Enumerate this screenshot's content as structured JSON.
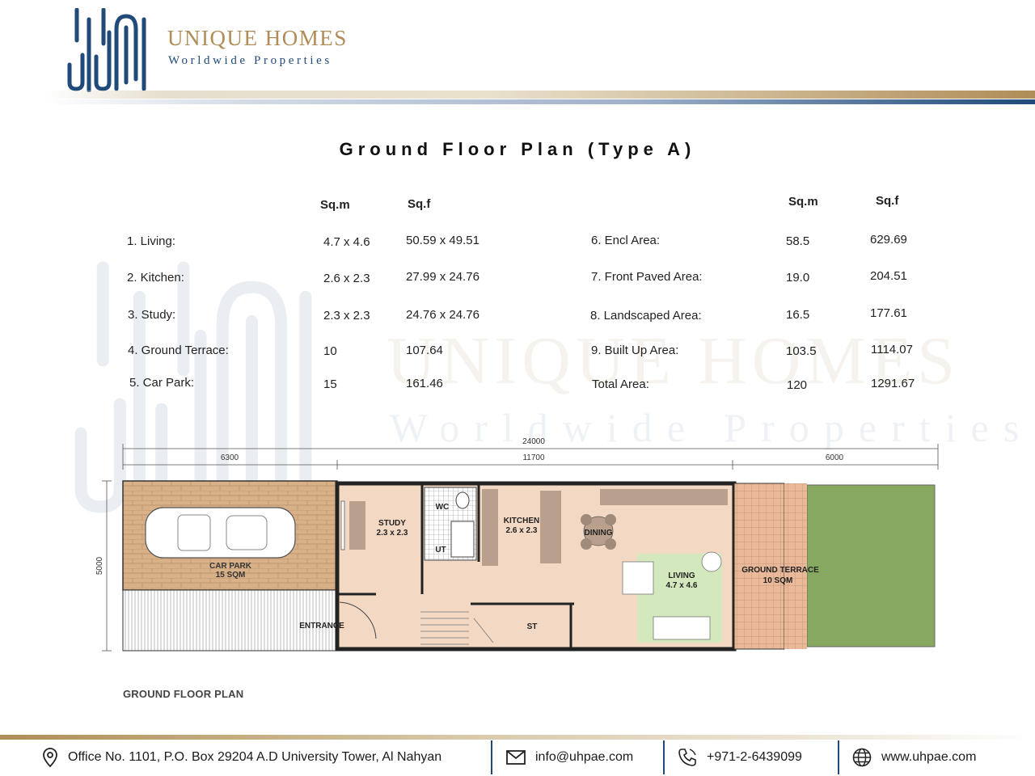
{
  "brand": {
    "name": "UNIQUE HOMES",
    "tagline": "Worldwide Properties"
  },
  "title": "Ground Floor Plan (Type A)",
  "table": {
    "left_headers": {
      "sqm": "Sq.m",
      "sqf": "Sq.f"
    },
    "right_headers": {
      "sqm": "Sq.m",
      "sqf": "Sq.f"
    },
    "left_rows": [
      {
        "label": "1. Living:",
        "sqm": "4.7 x 4.6",
        "sqf": "50.59 x 49.51"
      },
      {
        "label": "2. Kitchen:",
        "sqm": "2.6 x 2.3",
        "sqf": "27.99 x 24.76"
      },
      {
        "label": "3. Study:",
        "sqm": "2.3 x 2.3",
        "sqf": "24.76 x 24.76"
      },
      {
        "label": "4. Ground Terrace:",
        "sqm": "10",
        "sqf": "107.64"
      },
      {
        "label": "5. Car Park:",
        "sqm": "15",
        "sqf": "161.46"
      }
    ],
    "right_rows": [
      {
        "label": "6. Encl Area:",
        "sqm": "58.5",
        "sqf": "629.69"
      },
      {
        "label": "7. Front Paved Area:",
        "sqm": "19.0",
        "sqf": "204.51"
      },
      {
        "label": "8. Landscaped Area:",
        "sqm": "16.5",
        "sqf": "177.61"
      },
      {
        "label": "9. Built Up Area:",
        "sqm": "103.5",
        "sqf": "1114.07"
      },
      {
        "label": "Total Area:",
        "sqm": "120",
        "sqf": "1291.67"
      }
    ]
  },
  "plan": {
    "caption": "GROUND FLOOR PLAN",
    "dims": {
      "total": "24000",
      "left": "6300",
      "middle": "11700",
      "right": "6000",
      "height": "5000"
    },
    "rooms": {
      "car_park": "CAR PARK",
      "car_park_area": "15 SQM",
      "entrance": "ENTRANCE",
      "study": "STUDY",
      "study_size": "2.3 x 2.3",
      "wc": "WC",
      "ut": "UT",
      "kitchen": "KITCHEN",
      "kitchen_size": "2.6 x 2.3",
      "dining": "DINING",
      "living": "LIVING",
      "living_size": "4.7 x 4.6",
      "st": "ST",
      "terrace": "GROUND TERRACE",
      "terrace_area": "10 SQM"
    }
  },
  "footer": {
    "address": "Office No. 1101,  P.O. Box 29204  A.D University Tower,  Al Nahyan",
    "email": "info@uhpae.com",
    "phone": "+971-2-6439099",
    "website": "www.uhpae.com"
  },
  "icons": [
    "location-pin-icon",
    "envelope-icon",
    "phone-icon",
    "globe-icon"
  ],
  "colors": {
    "gold": "#b08d57",
    "navy": "#1f4a7a",
    "floor": "#f3d9c4",
    "terrace": "#e9b99a",
    "lawn": "#86a860",
    "living_rug": "#d4e8bd"
  }
}
